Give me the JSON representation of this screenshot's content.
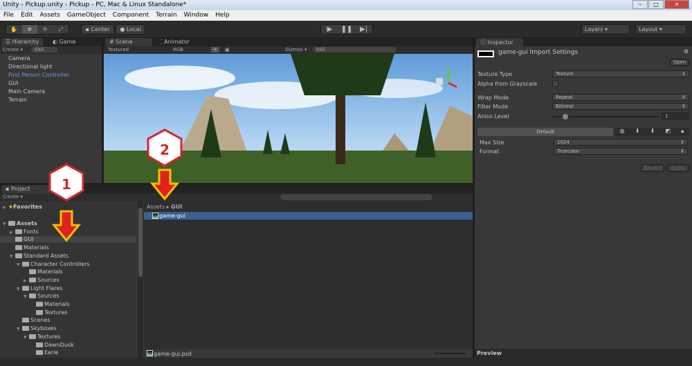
{
  "window": {
    "title": "Unity - Pickup.unity - Pickup - PC, Mac & Linux Standalone*"
  },
  "menu": [
    "File",
    "Edit",
    "Assets",
    "GameObject",
    "Component",
    "Terrain",
    "Window",
    "Help"
  ],
  "toolbar": {
    "center": "Center",
    "local": "Local",
    "layers": "Layers",
    "layout": "Layout"
  },
  "hierarchy": {
    "tab": "Hierarchy",
    "game_tab": "Game",
    "create": "Create",
    "search": "All",
    "items": [
      {
        "label": "Camera"
      },
      {
        "label": "Directional light"
      },
      {
        "label": "First Person Controller",
        "selected": true
      },
      {
        "label": "GUI"
      },
      {
        "label": "Main Camera"
      },
      {
        "label": "Terrain"
      }
    ]
  },
  "scene": {
    "tab": "Scene",
    "animator_tab": "Animator",
    "shading": "Textured",
    "channel": "RGB",
    "gizmos": "Gizmos",
    "search": "All"
  },
  "inspector": {
    "tab": "Inspector",
    "title": "game-gui Import Settings",
    "open": "Open",
    "texture_type_label": "Texture Type",
    "texture_type": "Texture",
    "alpha_label": "Alpha from Grayscale",
    "wrap_label": "Wrap Mode",
    "wrap": "Repeat",
    "filter_label": "Filter Mode",
    "filter": "Bilinear",
    "aniso_label": "Aniso Level",
    "aniso": "1",
    "default_tab": "Default",
    "max_size_label": "Max Size",
    "max_size": "1024",
    "format_label": "Format",
    "format": "Truecolor",
    "revert": "Revert",
    "apply": "Apply",
    "preview": "Preview"
  },
  "project": {
    "tab": "Project",
    "create": "Create",
    "favorites": "Favorites",
    "tree": [
      {
        "label": "Assets",
        "depth": 0,
        "bold": true
      },
      {
        "label": "Fonts",
        "depth": 1
      },
      {
        "label": "GUI",
        "depth": 1,
        "selected": true
      },
      {
        "label": "Materials",
        "depth": 1
      },
      {
        "label": "Standard Assets",
        "depth": 1
      },
      {
        "label": "Character Controllers",
        "depth": 2
      },
      {
        "label": "Materials",
        "depth": 3
      },
      {
        "label": "Sources",
        "depth": 3
      },
      {
        "label": "Light Flares",
        "depth": 2
      },
      {
        "label": "Sources",
        "depth": 3
      },
      {
        "label": "Materials",
        "depth": 4
      },
      {
        "label": "Textures",
        "depth": 4
      },
      {
        "label": "Scenes",
        "depth": 2
      },
      {
        "label": "Skyboxes",
        "depth": 2
      },
      {
        "label": "Textures",
        "depth": 3
      },
      {
        "label": "DawnDusk",
        "depth": 4
      },
      {
        "label": "Eerie",
        "depth": 4
      }
    ],
    "breadcrumb": [
      "Assets",
      "GUI"
    ],
    "file": "game-gui",
    "footer_file": "game-gui.psd"
  },
  "annotations": [
    "1",
    "2"
  ],
  "colors": {
    "selection": "#3d6091",
    "badge_red": "#d0282a",
    "arrow_yellow": "#f5c000"
  }
}
